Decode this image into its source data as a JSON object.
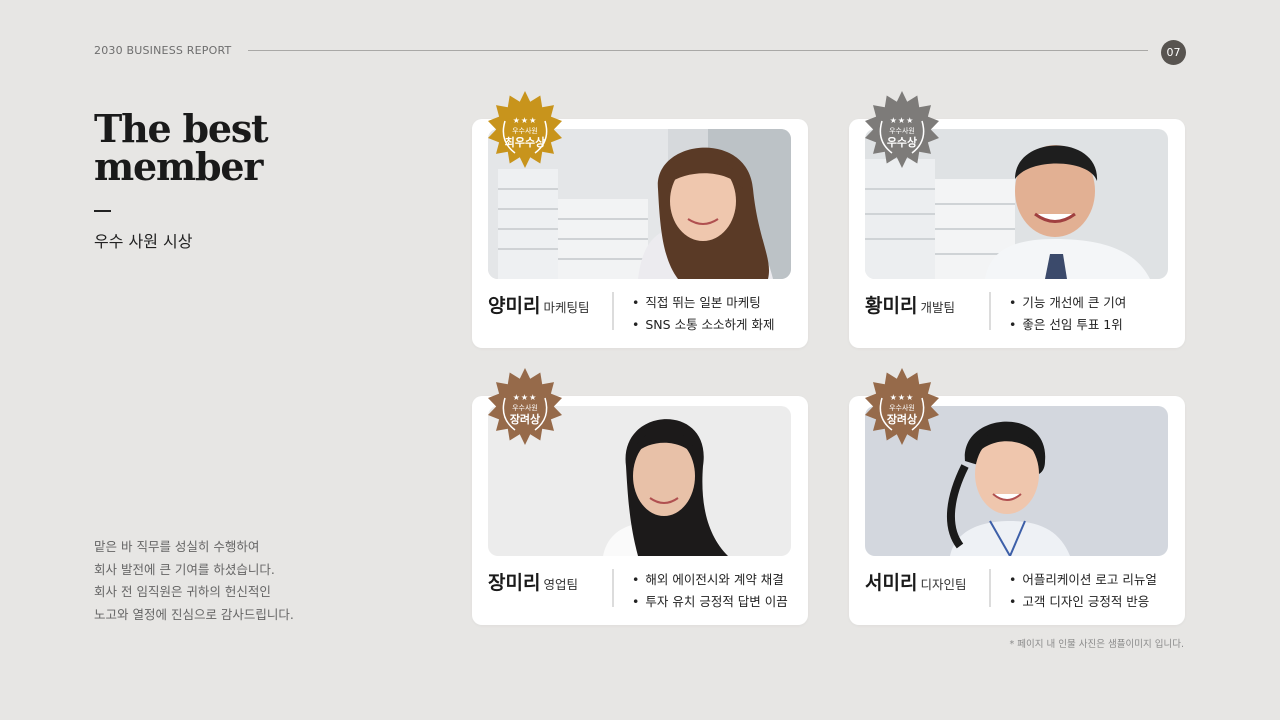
{
  "header": {
    "report_label": "2030 BUSINESS REPORT",
    "page_number": "07"
  },
  "title": {
    "line1": "The best",
    "line2": "member",
    "subtitle": "우수 사원 시상"
  },
  "message": {
    "lines": [
      "맡은 바 직무를 성실히 수행하여",
      "회사 발전에 큰 기여를 하셨습니다.",
      "회사 전 임직원은 귀하의 헌신적인",
      "노고와 열정에 진심으로 감사드립니다."
    ]
  },
  "note": "* 페이지 내 인물 사진은 샘플이미지 입니다.",
  "cards": [
    {
      "name": "양미리",
      "team": "마케팅팀",
      "badge_small": "우수사원",
      "badge_main": "최우수상",
      "badge_stars": "★★★",
      "badge_color": "#c8941c",
      "bullets": [
        "직접 뛰는 일본 마케팅",
        "SNS 소통 소소하게 화제"
      ]
    },
    {
      "name": "황미리",
      "team": "개발팀",
      "badge_small": "우수사원",
      "badge_main": "우수상",
      "badge_stars": "★★★",
      "badge_color": "#7d7b79",
      "bullets": [
        "기능 개선에 큰 기여",
        "좋은 선임 투표 1위"
      ]
    },
    {
      "name": "장미리",
      "team": "영업팀",
      "badge_small": "우수사원",
      "badge_main": "장려상",
      "badge_stars": "★★★",
      "badge_color": "#966a4a",
      "bullets": [
        "해외 에이전시와 계약 채결",
        "투자 유치 긍정적 답변 이끔"
      ]
    },
    {
      "name": "서미리",
      "team": "디자인팀",
      "badge_small": "우수사원",
      "badge_main": "장려상",
      "badge_stars": "★★★",
      "badge_color": "#966a4a",
      "bullets": [
        "어플리케이션 로고 리뉴얼",
        "고객 디자인 긍정적 반응"
      ]
    }
  ]
}
